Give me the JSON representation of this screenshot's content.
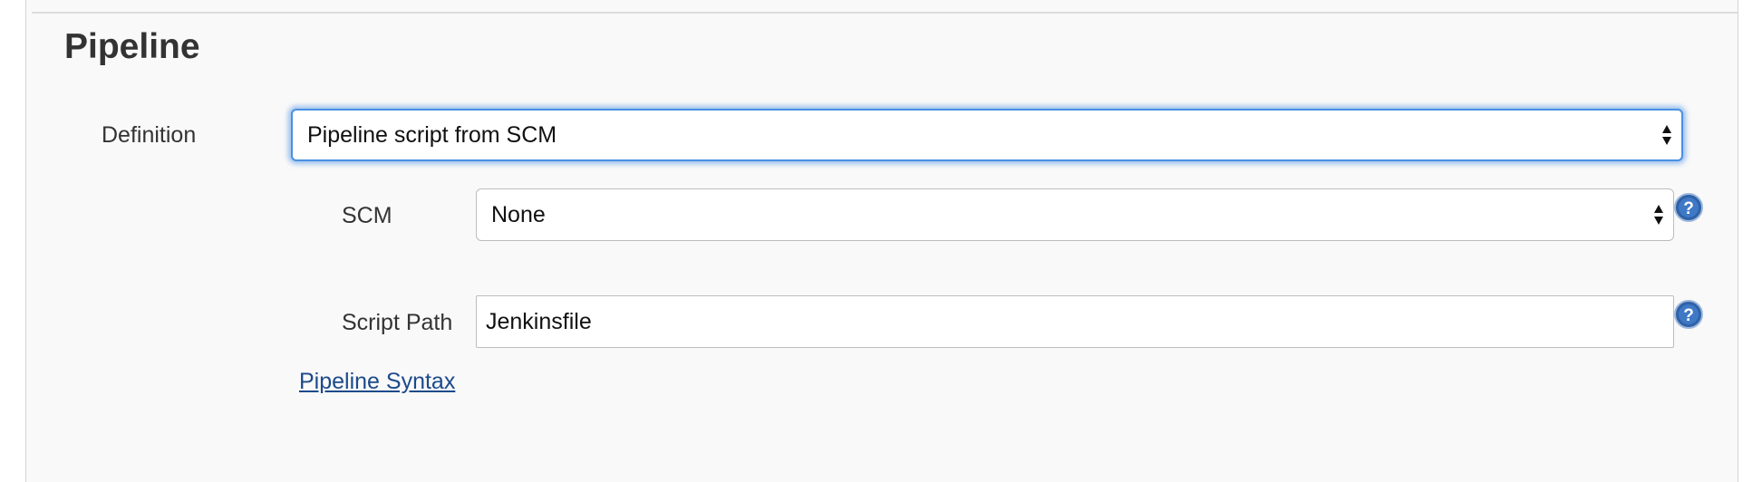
{
  "section": {
    "title": "Pipeline"
  },
  "definition": {
    "label": "Definition",
    "selected": "Pipeline script from SCM"
  },
  "scm": {
    "label": "SCM",
    "selected": "None"
  },
  "script_path": {
    "label": "Script Path",
    "value": "Jenkinsfile"
  },
  "links": {
    "pipeline_syntax": "Pipeline Syntax"
  },
  "icons": {
    "help": "help-icon",
    "select_arrows": "sort-arrows-icon"
  },
  "colors": {
    "focus_ring": "#4a90e2",
    "link": "#1c4a8a",
    "help_icon": "#2f62a6"
  }
}
